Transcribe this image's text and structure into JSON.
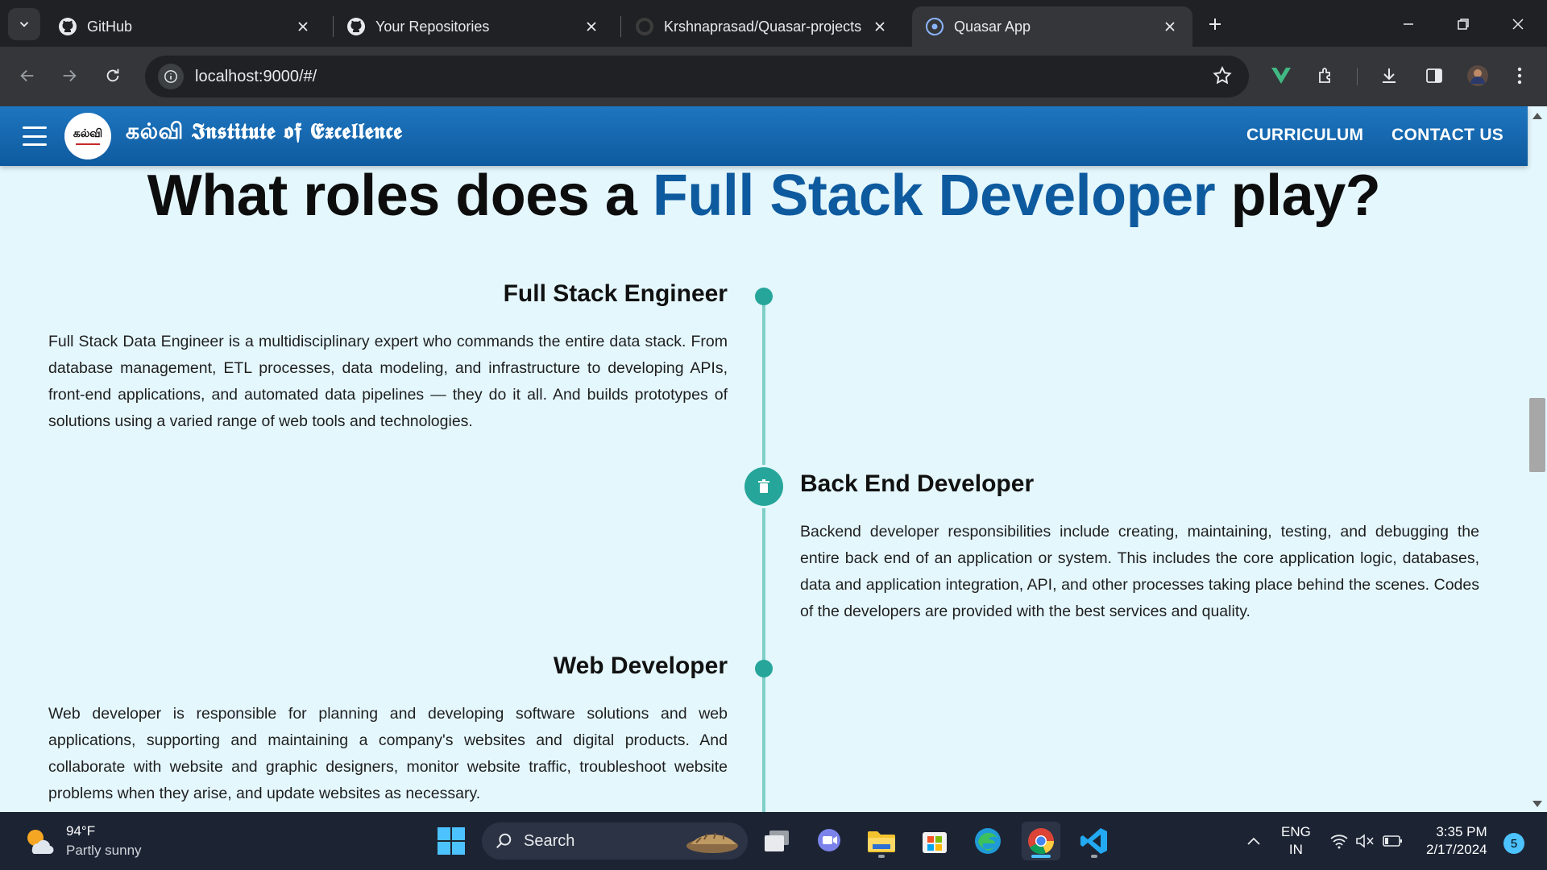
{
  "browser": {
    "tabs": [
      {
        "title": "GitHub",
        "icon": "github-icon",
        "active": false
      },
      {
        "title": "Your Repositories",
        "icon": "github-icon",
        "active": false
      },
      {
        "title": "Krshnaprasad/Quasar-projects",
        "icon": "github-icon",
        "active": false
      },
      {
        "title": "Quasar App",
        "icon": "quasar-icon",
        "active": true
      }
    ],
    "url": "localhost:9000/#/"
  },
  "app": {
    "logo_text": "கல்வி",
    "brand_title": "கல்வி 𝕴𝖓𝖘𝖙𝖎𝖙𝖚𝖙𝖊 𝖔𝖋 𝕰𝖝𝖈𝖊𝖑𝖑𝖊𝖓𝖈𝖊",
    "nav": [
      {
        "label": "CURRICULUM"
      },
      {
        "label": "CONTACT US"
      }
    ],
    "heading": {
      "prefix": "What roles does a ",
      "accent": "Full Stack Developer",
      "suffix": " play?"
    },
    "roles": [
      {
        "title": "Full Stack Engineer",
        "body": "Full Stack Data Engineer is a multidisciplinary expert who commands the entire data stack. From database management, ETL processes, data modeling, and infrastructure to developing APIs, front-end applications, and automated data pipelines — they do it all. And builds prototypes of solutions using a varied range of web tools and technologies."
      },
      {
        "title": "Back End Developer",
        "body": "Backend developer responsibilities include creating, maintaining, testing, and debugging the entire back end of an application or system. This includes the core application logic, databases, data and application integration, API, and other processes taking place behind the scenes. Codes of the developers are provided with the best services and quality."
      },
      {
        "title": "Web Developer",
        "body": "Web developer is responsible for planning and developing software solutions and web applications, supporting and maintaining a company's websites and digital products. And collaborate with website and graphic designers, monitor website traffic, troubleshoot website problems when they arise, and update websites as necessary."
      }
    ],
    "colors": {
      "header": "#0e5a9e",
      "accent": "#0e5a9e",
      "timeline": "#26a69a",
      "background": "#e4f7fd"
    }
  },
  "taskbar": {
    "weather_temp": "94°F",
    "weather_desc": "Partly sunny",
    "search_label": "Search",
    "lang_top": "ENG",
    "lang_bottom": "IN",
    "time": "3:35 PM",
    "date": "2/17/2024",
    "notification_count": "5"
  }
}
